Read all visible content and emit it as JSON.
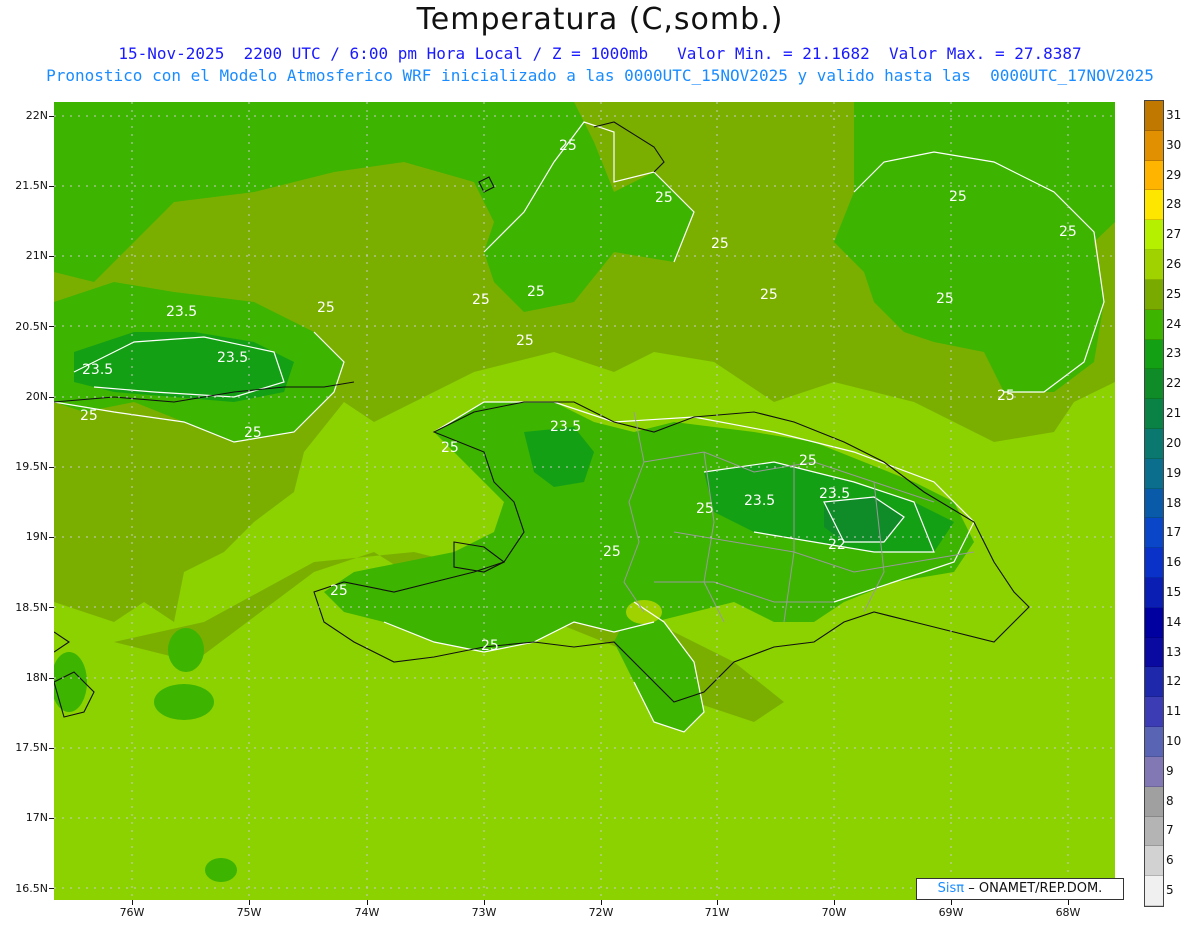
{
  "header": {
    "title": "Temperatura (C,somb.)",
    "line1": "15-Nov-2025  2200 UTC / 6:00 pm Hora Local / Z = 1000mb   Valor Min. = 21.1682  Valor Max. = 27.8387",
    "line2": "Pronostico con el Modelo Atmosferico WRF inicializado a las 0000UTC_15NOV2025 y valido hasta las  0000UTC_17NOV2025"
  },
  "axes": {
    "lat_labels": [
      "22N",
      "21.5N",
      "21N",
      "20.5N",
      "20N",
      "19.5N",
      "19N",
      "18.5N",
      "18N",
      "17.5N",
      "17N",
      "16.5N"
    ],
    "lon_labels": [
      "76W",
      "75W",
      "74W",
      "73W",
      "72W",
      "71W",
      "70W",
      "69W",
      "68W"
    ]
  },
  "colorbar": {
    "levels": [
      "31",
      "30",
      "29",
      "28",
      "27",
      "26",
      "25",
      "24",
      "23",
      "22",
      "21",
      "20",
      "19",
      "18",
      "17",
      "16",
      "15",
      "14",
      "13",
      "12",
      "11",
      "10",
      "9",
      "8",
      "7",
      "6",
      "5"
    ],
    "colors": [
      "#c07800",
      "#e09000",
      "#ffb400",
      "#ffe600",
      "#b4f000",
      "#a0d200",
      "#78aa00",
      "#3cb400",
      "#14a014",
      "#0f8c28",
      "#0a8246",
      "#0a786e",
      "#0a6e8c",
      "#0a5aaa",
      "#0a46c8",
      "#0a32c8",
      "#0a1eb4",
      "#0000a0",
      "#0a0aa0",
      "#1e28aa",
      "#3c3cb4",
      "#5a64b4",
      "#8278b4",
      "#a0a0a0",
      "#b4b4b4",
      "#d2d2d2",
      "#f0f0f0"
    ]
  },
  "contours": {
    "labels": [
      "25",
      "25",
      "25",
      "25",
      "25",
      "25",
      "25",
      "25",
      "25",
      "25",
      "25",
      "25",
      "25",
      "25",
      "25",
      "25",
      "25",
      "25",
      "25",
      "25",
      "23.5",
      "23.5",
      "23.5",
      "23.5",
      "23.5",
      "23.5",
      "22"
    ]
  },
  "credit": {
    "brand": "Sisπ",
    "text": "– ONAMET/REP.DOM."
  }
}
